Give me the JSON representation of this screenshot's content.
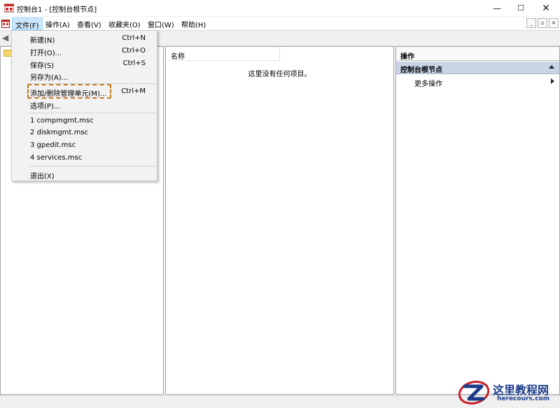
{
  "window": {
    "title": "控制台1 - [控制台根节点]",
    "controls": {
      "minimize": "—",
      "maximize": "☐",
      "close": "✕"
    }
  },
  "menubar": {
    "items": [
      "文件(F)",
      "操作(A)",
      "查看(V)",
      "收藏夹(O)",
      "窗口(W)",
      "帮助(H)"
    ],
    "active": "文件(F)",
    "mdi_controls": [
      "_",
      "▫",
      "×"
    ]
  },
  "file_menu": {
    "new": {
      "label": "新建(N)",
      "shortcut": "Ctrl+N"
    },
    "open": {
      "label": "打开(O)...",
      "shortcut": "Ctrl+O"
    },
    "save": {
      "label": "保存(S)",
      "shortcut": "Ctrl+S"
    },
    "save_as": {
      "label": "另存为(A)..."
    },
    "add_remove_snapin": {
      "label": "添加/删除管理单元(M)...",
      "shortcut": "Ctrl+M"
    },
    "options": {
      "label": "选项(P)..."
    },
    "recent": [
      "1 compmgmt.msc",
      "2 diskmgmt.msc",
      "3 gpedit.msc",
      "4 services.msc"
    ],
    "exit": {
      "label": "退出(X)"
    }
  },
  "center_pane": {
    "column_name": "名称",
    "empty_message": "这里没有任何项目。"
  },
  "actions_pane": {
    "title": "操作",
    "section": "控制台根节点",
    "more": "更多操作"
  },
  "watermark": {
    "title": "这里教程网",
    "subtitle": "herecours.com"
  },
  "colors": {
    "menu_highlight": "#cce8ff",
    "actions_section_bg": "#c7d5e5",
    "annotation_dashed": "#c07820",
    "watermark_blue": "#1c3c8a",
    "watermark_red": "#c8202a"
  }
}
